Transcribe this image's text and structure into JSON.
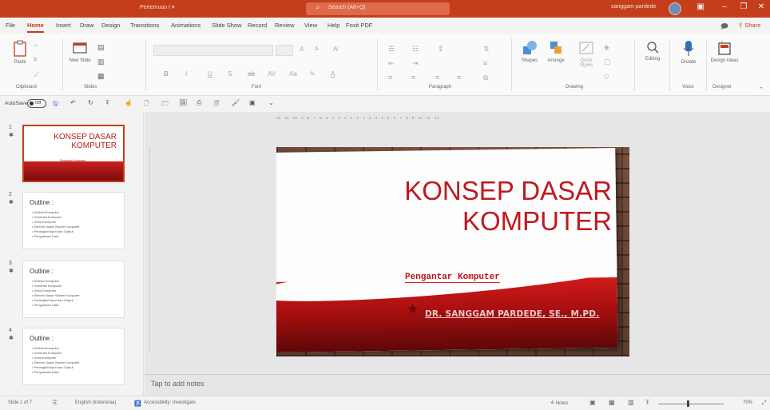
{
  "titlebar": {
    "doc_title": "Pertemuan I  ▾",
    "search_placeholder": "Search (Alt+Q)",
    "user_name": "sanggam pardede"
  },
  "tabs": [
    "File",
    "Home",
    "Insert",
    "Draw",
    "Design",
    "Transitions",
    "Animations",
    "Slide Show",
    "Record",
    "Review",
    "View",
    "Help",
    "Foxit PDF"
  ],
  "active_tab": "Home",
  "share_label": "Share",
  "ribbon": {
    "groups": {
      "clipboard": "Clipboard",
      "slides": "Slides",
      "font": "Font",
      "paragraph": "Paragraph",
      "drawing": "Drawing",
      "voice": "Voice",
      "designer": "Designer"
    },
    "paste_label": "Paste",
    "new_slide_label": "New Slide",
    "shapes_label": "Shapes",
    "arrange_label": "Arrange",
    "quick_styles_label": "Quick Styles",
    "editing_label": "Editing",
    "dictate_label": "Dictate",
    "design_ideas_label": "Design Ideas"
  },
  "qat": {
    "autosave_label": "AutoSave",
    "autosave_state": "Off"
  },
  "ruler_text": "12 · 11 · 10 · 9 · 8 · 7 · 6 · 5 · 4 · 3 · 2 · 1 · 0 · 1 · 2 · 3 · 4 · 5 · 6 · 7 · 8 · 9 · 10 · 11 · 12",
  "thumbnails": [
    {
      "num": "1",
      "title": "KONSEP DASAR KOMPUTER",
      "subtitle": "Pengantar Komputer"
    },
    {
      "num": "2",
      "title": "Outline :",
      "items": [
        "Definisi Komputer",
        "Generasi Komputer",
        "Jenis Komputer",
        "Elemen Dasar Sistem Komputer",
        "Perangkat Input dan Output",
        "Pengolahan Data"
      ]
    },
    {
      "num": "3",
      "title": "Outline :",
      "items": [
        "Definisi Komputer",
        "Generasi Komputer",
        "Jenis Komputer",
        "Elemen Dasar Sistem Komputer",
        "Perangkat Input dan Output",
        "Pengolahan Data"
      ]
    },
    {
      "num": "4",
      "title": "Outline :",
      "items": [
        "Definisi Komputer",
        "Generasi Komputer",
        "Jenis Komputer",
        "Elemen Dasar Sistem Komputer",
        "Perangkat Input dan Output",
        "Pengolahan Data"
      ]
    }
  ],
  "slide": {
    "title_line1": "KONSEP DASAR",
    "title_line2": "KOMPUTER",
    "subtitle": "Pengantar Komputer",
    "author": "DR. SANGGAM PARDEDE, SE., M.PD."
  },
  "notes_placeholder": "Tap to add notes",
  "status": {
    "slide_count": "Slide 1 of 7",
    "language": "English (Indonesia)",
    "accessibility": "Accessibility: Investigate",
    "notes_label": "Notes",
    "zoom": "70%"
  },
  "colors": {
    "accent": "#c43e1c",
    "slide_red": "#c0191f"
  }
}
